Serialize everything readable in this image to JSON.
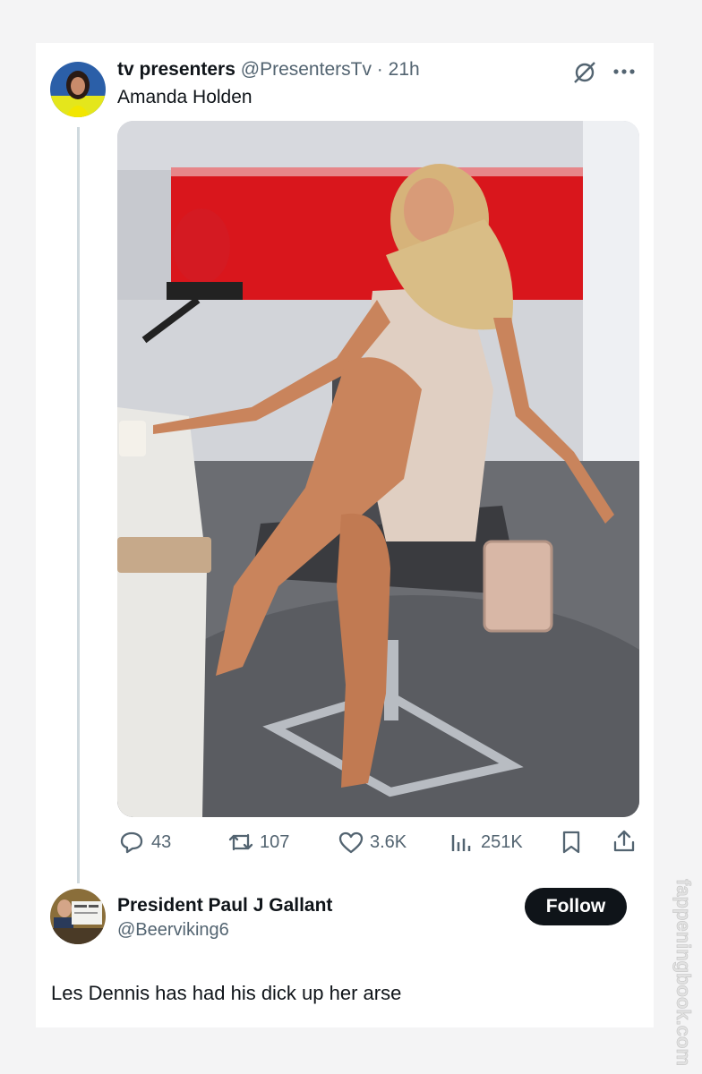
{
  "tweet": {
    "author_name": "tv presenters",
    "handle": "@PresentersTv",
    "separator": "·",
    "time": "21h",
    "text": "Amanda Holden",
    "media_alt": "woman seated on a studio chair",
    "stats": {
      "replies": "43",
      "retweets": "107",
      "likes": "3.6K",
      "views": "251K"
    }
  },
  "reply": {
    "author_name": "President Paul J Gallant",
    "handle": "@Beerviking6",
    "follow_label": "Follow",
    "text": "Les Dennis has had his dick up her arse"
  },
  "watermark": "fappeningbook.com",
  "colors": {
    "primary_text": "#0f1419",
    "secondary_text": "#536471",
    "follow_bg": "#0f1419",
    "studio_red": "#d9161c"
  },
  "icons": [
    "grok-icon",
    "more-icon",
    "reply-icon",
    "retweet-icon",
    "like-icon",
    "views-icon",
    "bookmark-icon",
    "share-icon"
  ]
}
